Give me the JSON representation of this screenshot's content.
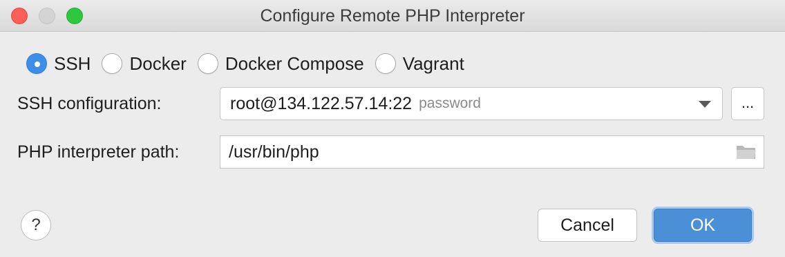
{
  "window": {
    "title": "Configure Remote PHP Interpreter"
  },
  "radio_options": [
    {
      "label": "SSH",
      "checked": true
    },
    {
      "label": "Docker",
      "checked": false
    },
    {
      "label": "Docker Compose",
      "checked": false
    },
    {
      "label": "Vagrant",
      "checked": false
    }
  ],
  "ssh_configuration": {
    "label": "SSH configuration:",
    "value": "root@134.122.57.14:22",
    "auth_hint": "password",
    "browse_label": "..."
  },
  "interpreter_path": {
    "label": "PHP interpreter path:",
    "value": "/usr/bin/php"
  },
  "footer": {
    "help_label": "?",
    "cancel_label": "Cancel",
    "ok_label": "OK"
  },
  "colors": {
    "accent": "#4b8fd6",
    "close": "#fc5f57",
    "maximize": "#2ec840"
  }
}
